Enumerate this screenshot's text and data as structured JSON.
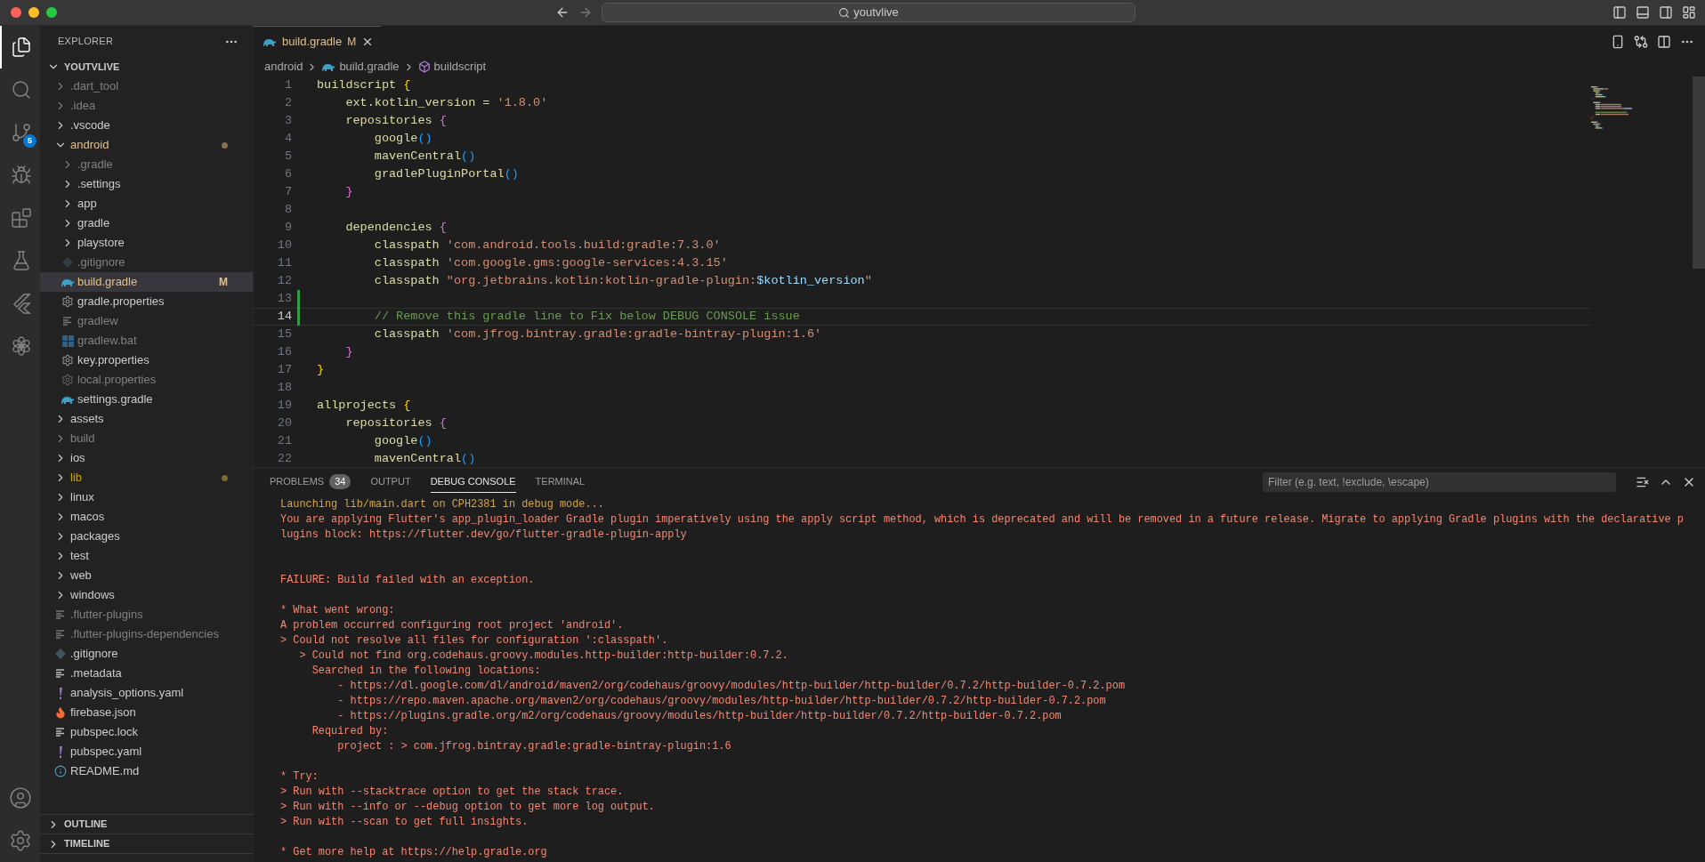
{
  "window": {
    "search": "youtvlive"
  },
  "activity_bar": {
    "items": [
      {
        "kind": "files",
        "selected": true
      },
      {
        "kind": "search",
        "selected": false
      },
      {
        "kind": "source-control",
        "selected": false,
        "badge": "5"
      },
      {
        "kind": "run-debug",
        "selected": false
      },
      {
        "kind": "extensions",
        "selected": false
      },
      {
        "kind": "testing",
        "selected": false
      },
      {
        "kind": "flutter",
        "selected": false
      },
      {
        "kind": "knot",
        "selected": false
      }
    ],
    "bottom": [
      {
        "kind": "account"
      },
      {
        "kind": "settings"
      }
    ]
  },
  "sidebar": {
    "title": "EXPLORER",
    "project": {
      "name": "YOUTVLIVE",
      "expanded": true,
      "children": [
        {
          "name": ".dart_tool",
          "kind": "folder",
          "expanded": false,
          "ignored": true,
          "selected": false,
          "modified": false,
          "warning": false
        },
        {
          "name": ".idea",
          "kind": "folder",
          "expanded": false,
          "ignored": true,
          "selected": false,
          "modified": false,
          "warning": false
        },
        {
          "name": ".vscode",
          "kind": "folder",
          "expanded": false,
          "ignored": false,
          "selected": false,
          "modified": false,
          "warning": false
        },
        {
          "name": "android",
          "kind": "folder",
          "expanded": true,
          "ignored": false,
          "selected": false,
          "modified": true,
          "warning": false,
          "children": [
            {
              "name": ".gradle",
              "kind": "folder",
              "expanded": false,
              "ignored": true,
              "selected": false,
              "modified": false,
              "warning": false
            },
            {
              "name": ".settings",
              "kind": "folder",
              "expanded": false,
              "ignored": false,
              "selected": false,
              "modified": false,
              "warning": false
            },
            {
              "name": "app",
              "kind": "folder",
              "expanded": false,
              "ignored": false,
              "selected": false,
              "modified": false,
              "warning": false
            },
            {
              "name": "gradle",
              "kind": "folder",
              "expanded": false,
              "ignored": false,
              "selected": false,
              "modified": false,
              "warning": false
            },
            {
              "name": "playstore",
              "kind": "folder",
              "expanded": false,
              "ignored": false,
              "selected": false,
              "modified": false,
              "warning": false
            },
            {
              "name": ".gitignore",
              "kind": "git",
              "ignored": true,
              "selected": false,
              "modified": false,
              "warning": false
            },
            {
              "name": "build.gradle",
              "kind": "gradle",
              "ignored": false,
              "selected": true,
              "modified": true,
              "warning": false,
              "badge": "M"
            },
            {
              "name": "gradle.properties",
              "kind": "gear",
              "ignored": false,
              "selected": false,
              "modified": false,
              "warning": false
            },
            {
              "name": "gradlew",
              "kind": "lines",
              "ignored": true,
              "selected": false,
              "modified": false,
              "warning": false
            },
            {
              "name": "gradlew.bat",
              "kind": "windows",
              "ignored": true,
              "selected": false,
              "modified": false,
              "warning": false
            },
            {
              "name": "key.properties",
              "kind": "gear",
              "ignored": false,
              "selected": false,
              "modified": false,
              "warning": false
            },
            {
              "name": "local.properties",
              "kind": "gear",
              "ignored": true,
              "selected": false,
              "modified": false,
              "warning": false
            },
            {
              "name": "settings.gradle",
              "kind": "gradle",
              "ignored": false,
              "selected": false,
              "modified": false,
              "warning": false
            }
          ]
        },
        {
          "name": "assets",
          "kind": "folder",
          "expanded": false,
          "ignored": false,
          "selected": false,
          "modified": false,
          "warning": false
        },
        {
          "name": "build",
          "kind": "folder",
          "expanded": false,
          "ignored": true,
          "selected": false,
          "modified": false,
          "warning": false
        },
        {
          "name": "ios",
          "kind": "folder",
          "expanded": false,
          "ignored": false,
          "selected": false,
          "modified": false,
          "warning": false
        },
        {
          "name": "lib",
          "kind": "folder",
          "expanded": false,
          "ignored": false,
          "selected": false,
          "modified": false,
          "warning": true
        },
        {
          "name": "linux",
          "kind": "folder",
          "expanded": false,
          "ignored": false,
          "selected": false,
          "modified": false,
          "warning": false
        },
        {
          "name": "macos",
          "kind": "folder",
          "expanded": false,
          "ignored": false,
          "selected": false,
          "modified": false,
          "warning": false
        },
        {
          "name": "packages",
          "kind": "folder",
          "expanded": false,
          "ignored": false,
          "selected": false,
          "modified": false,
          "warning": false
        },
        {
          "name": "test",
          "kind": "folder",
          "expanded": false,
          "ignored": false,
          "selected": false,
          "modified": false,
          "warning": false
        },
        {
          "name": "web",
          "kind": "folder",
          "expanded": false,
          "ignored": false,
          "selected": false,
          "modified": false,
          "warning": false
        },
        {
          "name": "windows",
          "kind": "folder",
          "expanded": false,
          "ignored": false,
          "selected": false,
          "modified": false,
          "warning": false
        },
        {
          "name": ".flutter-plugins",
          "kind": "lines",
          "ignored": true,
          "selected": false,
          "modified": false,
          "warning": false
        },
        {
          "name": ".flutter-plugins-dependencies",
          "kind": "lines",
          "ignored": true,
          "selected": false,
          "modified": false,
          "warning": false
        },
        {
          "name": ".gitignore",
          "kind": "git",
          "ignored": false,
          "selected": false,
          "modified": false,
          "warning": false
        },
        {
          "name": ".metadata",
          "kind": "lines",
          "ignored": false,
          "selected": false,
          "modified": false,
          "warning": false
        },
        {
          "name": "analysis_options.yaml",
          "kind": "yaml",
          "ignored": false,
          "selected": false,
          "modified": false,
          "warning": false
        },
        {
          "name": "firebase.json",
          "kind": "firebase",
          "ignored": false,
          "selected": false,
          "modified": false,
          "warning": false
        },
        {
          "name": "pubspec.lock",
          "kind": "lines",
          "ignored": false,
          "selected": false,
          "modified": false,
          "warning": false
        },
        {
          "name": "pubspec.yaml",
          "kind": "yaml",
          "ignored": false,
          "selected": false,
          "modified": false,
          "warning": false
        },
        {
          "name": "README.md",
          "kind": "info",
          "ignored": false,
          "selected": false,
          "modified": false,
          "warning": false
        }
      ]
    },
    "sections": [
      {
        "name": "OUTLINE",
        "expanded": false
      },
      {
        "name": "TIMELINE",
        "expanded": false
      }
    ]
  },
  "editor": {
    "tabs": [
      {
        "name": "build.gradle",
        "badge": "M",
        "selected": true
      }
    ],
    "breadcrumb": [
      {
        "label": "android",
        "kind": "folder"
      },
      {
        "label": "build.gradle",
        "kind": "gradle"
      },
      {
        "label": "buildscript",
        "kind": "symbol"
      }
    ],
    "lines": [
      {
        "n": "1",
        "modified": false,
        "current": false,
        "tokens": [
          {
            "kind": "fn",
            "t": "buildscript "
          },
          {
            "kind": "b1",
            "t": "{"
          }
        ]
      },
      {
        "n": "2",
        "modified": false,
        "current": false,
        "tokens": [
          {
            "kind": "fn",
            "t": "    ext.kotlin_version = "
          },
          {
            "kind": "str",
            "t": "'1.8.0'"
          }
        ]
      },
      {
        "n": "3",
        "modified": false,
        "current": false,
        "tokens": [
          {
            "kind": "fn",
            "t": "    repositories "
          },
          {
            "kind": "b2",
            "t": "{"
          }
        ]
      },
      {
        "n": "4",
        "modified": false,
        "current": false,
        "tokens": [
          {
            "kind": "fn",
            "t": "        google"
          },
          {
            "kind": "b3",
            "t": "()"
          }
        ]
      },
      {
        "n": "5",
        "modified": false,
        "current": false,
        "tokens": [
          {
            "kind": "fn",
            "t": "        mavenCentral"
          },
          {
            "kind": "b3",
            "t": "()"
          }
        ]
      },
      {
        "n": "6",
        "modified": false,
        "current": false,
        "tokens": [
          {
            "kind": "fn",
            "t": "        gradlePluginPortal"
          },
          {
            "kind": "b3",
            "t": "()"
          }
        ]
      },
      {
        "n": "7",
        "modified": false,
        "current": false,
        "tokens": [
          {
            "kind": "b2",
            "t": "    }"
          }
        ]
      },
      {
        "n": "8",
        "modified": false,
        "current": false
      },
      {
        "n": "9",
        "modified": false,
        "current": false,
        "tokens": [
          {
            "kind": "fn",
            "t": "    dependencies "
          },
          {
            "kind": "b2",
            "t": "{"
          }
        ]
      },
      {
        "n": "10",
        "modified": false,
        "current": false,
        "tokens": [
          {
            "kind": "fn",
            "t": "        classpath "
          },
          {
            "kind": "str",
            "t": "'com.android.tools.build:gradle:7.3.0'"
          }
        ]
      },
      {
        "n": "11",
        "modified": false,
        "current": false,
        "tokens": [
          {
            "kind": "fn",
            "t": "        classpath "
          },
          {
            "kind": "str",
            "t": "'com.google.gms:google-services:4.3.15'"
          }
        ]
      },
      {
        "n": "12",
        "modified": false,
        "current": false,
        "tokens": [
          {
            "kind": "fn",
            "t": "        classpath "
          },
          {
            "kind": "str",
            "t": "\"org.jetbrains.kotlin:kotlin-gradle-plugin:"
          },
          {
            "kind": "var",
            "t": "$kotlin_version"
          },
          {
            "kind": "str",
            "t": "\""
          }
        ]
      },
      {
        "n": "13",
        "modified": true,
        "current": false
      },
      {
        "n": "14",
        "modified": true,
        "current": true,
        "tokens": [
          {
            "kind": "comment",
            "t": "        // Remove this gradle line to Fix below DEBUG CONSOLE issue"
          }
        ]
      },
      {
        "n": "15",
        "modified": false,
        "current": false,
        "tokens": [
          {
            "kind": "fn",
            "t": "        classpath "
          },
          {
            "kind": "str",
            "t": "'com.jfrog.bintray.gradle:gradle-bintray-plugin:1.6'"
          }
        ]
      },
      {
        "n": "16",
        "modified": false,
        "current": false,
        "tokens": [
          {
            "kind": "b2",
            "t": "    }"
          }
        ]
      },
      {
        "n": "17",
        "modified": false,
        "current": false,
        "tokens": [
          {
            "kind": "b1",
            "t": "}"
          }
        ]
      },
      {
        "n": "18",
        "modified": false,
        "current": false
      },
      {
        "n": "19",
        "modified": false,
        "current": false,
        "tokens": [
          {
            "kind": "fn",
            "t": "allprojects "
          },
          {
            "kind": "b1",
            "t": "{"
          }
        ]
      },
      {
        "n": "20",
        "modified": false,
        "current": false,
        "tokens": [
          {
            "kind": "fn",
            "t": "    repositories "
          },
          {
            "kind": "b2",
            "t": "{"
          }
        ]
      },
      {
        "n": "21",
        "modified": false,
        "current": false,
        "tokens": [
          {
            "kind": "fn",
            "t": "        google"
          },
          {
            "kind": "b3",
            "t": "()"
          }
        ]
      },
      {
        "n": "22",
        "modified": false,
        "current": false,
        "tokens": [
          {
            "kind": "fn",
            "t": "        mavenCentral"
          },
          {
            "kind": "b3",
            "t": "()"
          }
        ]
      }
    ]
  },
  "panel": {
    "tabs": [
      {
        "label": "PROBLEMS",
        "badge": "34",
        "selected": false
      },
      {
        "label": "OUTPUT",
        "selected": false
      },
      {
        "label": "DEBUG CONSOLE",
        "selected": true
      },
      {
        "label": "TERMINAL",
        "selected": false
      }
    ],
    "filter": {
      "placeholder": "Filter (e.g. text, !exclude, \\escape)"
    },
    "lines": [
      {
        "kind": "info",
        "text": "Launching lib/main.dart on CPH2381 in debug mode..."
      },
      {
        "kind": "error",
        "text": "You are applying Flutter's app_plugin_loader Gradle plugin imperatively using the apply script method, which is deprecated and will be removed in a future release. Migrate to applying Gradle plugins with the declarative p"
      },
      {
        "kind": "error",
        "text": "lugins block: https://flutter.dev/go/flutter-gradle-plugin-apply"
      },
      {
        "kind": "blank"
      },
      {
        "kind": "blank"
      },
      {
        "kind": "error",
        "text": "FAILURE: Build failed with an exception."
      },
      {
        "kind": "blank"
      },
      {
        "kind": "error",
        "text": "* What went wrong:"
      },
      {
        "kind": "error",
        "text": "A problem occurred configuring root project 'android'."
      },
      {
        "kind": "error",
        "text": "> Could not resolve all files for configuration ':classpath'."
      },
      {
        "kind": "error",
        "text": "   > Could not find org.codehaus.groovy.modules.http-builder:http-builder:0.7.2."
      },
      {
        "kind": "error",
        "text": "     Searched in the following locations:"
      },
      {
        "kind": "error",
        "text": "         - https://dl.google.com/dl/android/maven2/org/codehaus/groovy/modules/http-builder/http-builder/0.7.2/http-builder-0.7.2.pom"
      },
      {
        "kind": "error",
        "text": "         - https://repo.maven.apache.org/maven2/org/codehaus/groovy/modules/http-builder/http-builder/0.7.2/http-builder-0.7.2.pom"
      },
      {
        "kind": "error",
        "text": "         - https://plugins.gradle.org/m2/org/codehaus/groovy/modules/http-builder/http-builder/0.7.2/http-builder-0.7.2.pom"
      },
      {
        "kind": "error",
        "text": "     Required by:"
      },
      {
        "kind": "error",
        "text": "         project : > com.jfrog.bintray.gradle:gradle-bintray-plugin:1.6"
      },
      {
        "kind": "blank"
      },
      {
        "kind": "error",
        "text": "* Try:"
      },
      {
        "kind": "error",
        "text": "> Run with --stacktrace option to get the stack trace."
      },
      {
        "kind": "error",
        "text": "> Run with --info or --debug option to get more log output."
      },
      {
        "kind": "error",
        "text": "> Run with --scan to get full insights."
      },
      {
        "kind": "blank"
      },
      {
        "kind": "error",
        "text": "* Get more help at https://help.gradle.org"
      }
    ]
  }
}
